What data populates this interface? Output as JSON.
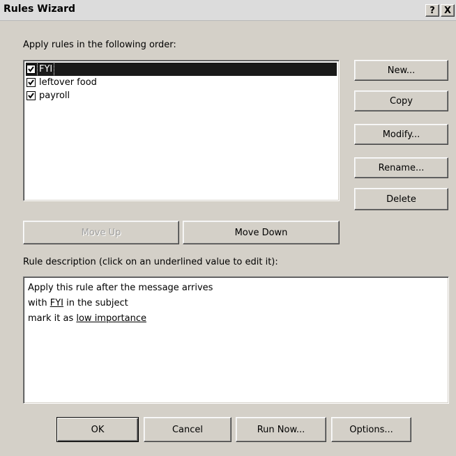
{
  "window": {
    "title": "Rules Wizard",
    "help_label": "?",
    "close_label": "X"
  },
  "rules_label": "Apply rules in the following order:",
  "rules": [
    {
      "label": "FYI",
      "checked": true,
      "selected": true
    },
    {
      "label": "leftover food",
      "checked": true,
      "selected": false
    },
    {
      "label": "payroll",
      "checked": true,
      "selected": false
    }
  ],
  "side_buttons": {
    "new": "New...",
    "copy": "Copy",
    "modify": "Modify...",
    "rename": "Rename...",
    "delete": "Delete"
  },
  "move_up": "Move Up",
  "move_down": "Move Down",
  "description_label": "Rule description (click on an underlined value to edit it):",
  "description": {
    "line1": "Apply this rule after the message arrives",
    "line2_prefix": "with ",
    "line2_link": "FYI",
    "line2_suffix": " in the subject",
    "line3_prefix": "mark it as ",
    "line3_link": "low importance"
  },
  "footer": {
    "ok": "OK",
    "cancel": "Cancel",
    "run_now": "Run Now...",
    "options": "Options..."
  },
  "colors": {
    "dialog_bg": "#d4d0c8",
    "selection_bg": "#1a1a1a"
  }
}
